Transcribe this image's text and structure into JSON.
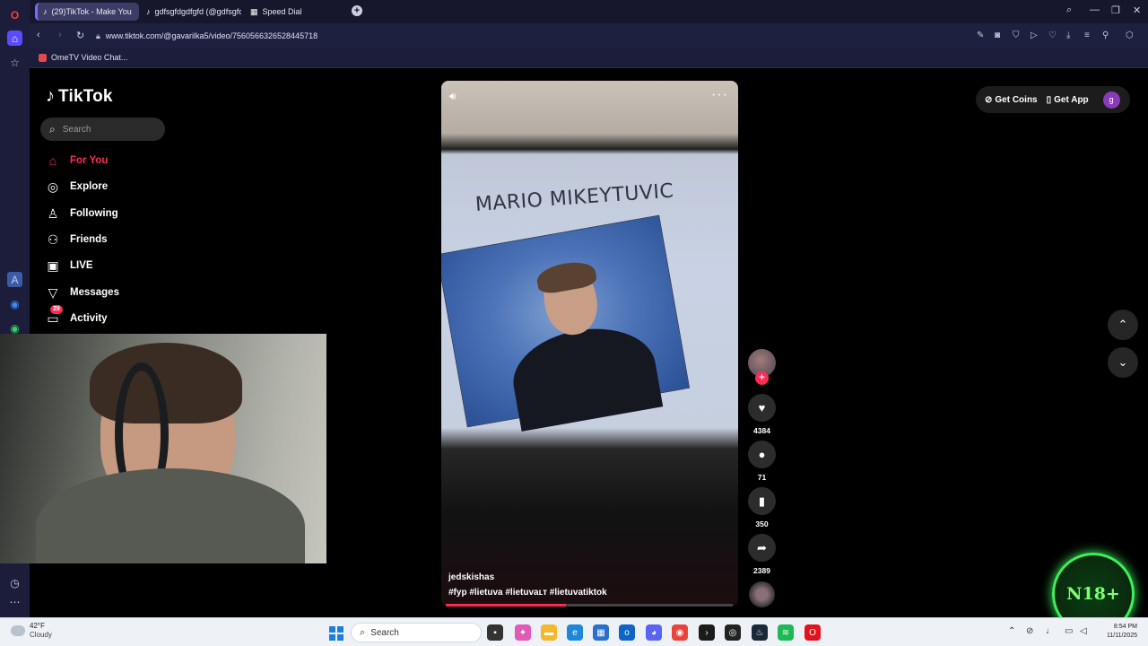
{
  "browser": {
    "tabs": [
      {
        "label": "(29)TikTok - Make You"
      },
      {
        "label": "gdfsgfdgdfgfd (@gdfsgfd"
      },
      {
        "label": "Speed Dial"
      }
    ],
    "url": "www.tiktok.com/@gavarilka5/video/7560566326528445718",
    "bookmark": "OmeTV Video Chat..."
  },
  "tiktok": {
    "logo": "TikTok",
    "search_placeholder": "Search",
    "nav": [
      {
        "label": "For You"
      },
      {
        "label": "Explore"
      },
      {
        "label": "Following"
      },
      {
        "label": "Friends"
      },
      {
        "label": "LIVE"
      },
      {
        "label": "Messages"
      },
      {
        "label": "Activity",
        "badge": "29"
      }
    ],
    "top_right": {
      "coins": "Get Coins",
      "app": "Get App",
      "user_initial": "g"
    },
    "video": {
      "screen_title": "MARIO MIKEYTUVIC",
      "author": "jedskishas",
      "hashtags": "#fyp #lietuva #lietuvaʟт #lietuvatiktok",
      "progress": 0.42
    },
    "actions": {
      "likes": "4384",
      "comments": "71",
      "saves": "350",
      "shares": "2389"
    }
  },
  "overlay": {
    "n18": "N18+"
  },
  "taskbar": {
    "weather_temp": "42°F",
    "weather_cond": "Cloudy",
    "search": "Search",
    "time": "8:54 PM",
    "date": "11/11/2025"
  },
  "colors": {
    "accent": "#fe2c55",
    "opera_bg": "#1b1d3a",
    "n18_green": "#3df05a"
  }
}
